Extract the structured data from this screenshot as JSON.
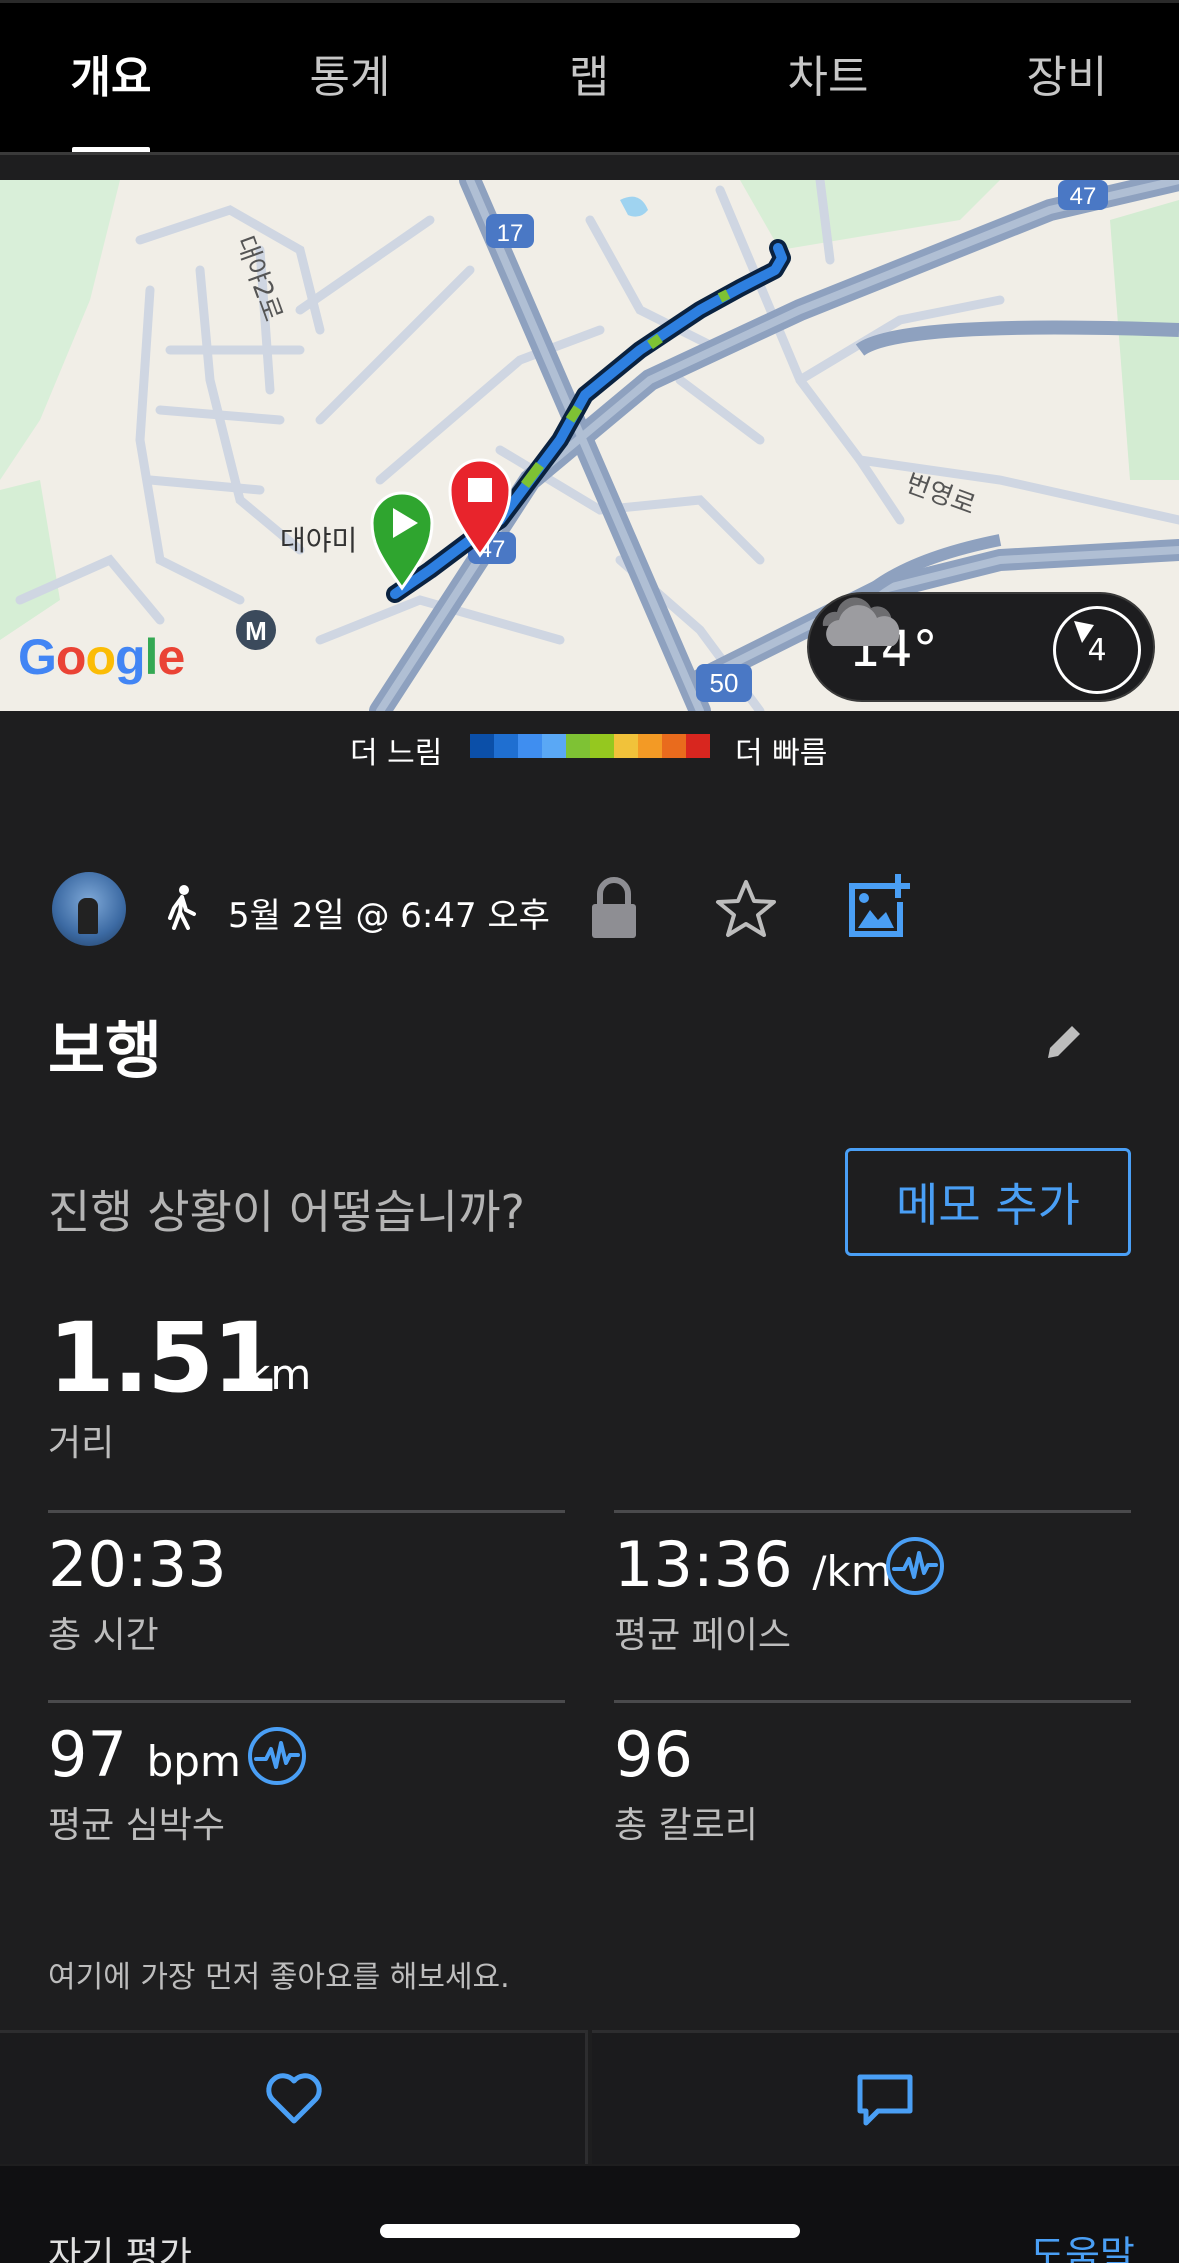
{
  "tabs": [
    {
      "label": "개요",
      "active": true
    },
    {
      "label": "통계",
      "active": false
    },
    {
      "label": "랩",
      "active": false
    },
    {
      "label": "차트",
      "active": false
    },
    {
      "label": "장비",
      "active": false
    }
  ],
  "map": {
    "road_labels": [
      "대야2로",
      "대야미",
      "번영로"
    ],
    "route_shields": [
      "17",
      "47",
      "47",
      "50"
    ],
    "metro_icon_letter": "M",
    "provider_logo": "Google",
    "weather": {
      "temperature": "14°",
      "icon": "cloud-icon",
      "wind_speed": "4"
    }
  },
  "legend": {
    "slow_label": "더 느림",
    "fast_label": "더 빠름",
    "colors": [
      "#0b4fa8",
      "#1f6fd1",
      "#3f8ef0",
      "#5aa8f5",
      "#7ec234",
      "#95c81f",
      "#f1c23a",
      "#f39a25",
      "#e96b1d",
      "#d8261f"
    ]
  },
  "activity": {
    "type_icon": "walk-icon",
    "date": "5월 2일 @ 6:47 오후",
    "title": "보행",
    "prompt": "진행 상황이 어떻습니까?",
    "memo_button": "메모 추가"
  },
  "stats": {
    "distance": {
      "value": "1.51",
      "unit": "km",
      "label": "거리"
    },
    "total_time": {
      "value": "20:33",
      "label": "총 시간"
    },
    "avg_pace": {
      "value": "13:36",
      "unit": "/km",
      "label": "평균 페이스"
    },
    "avg_hr": {
      "value": "97",
      "unit": "bpm",
      "label": "평균 심박수"
    },
    "calories": {
      "value": "96",
      "label": "총 칼로리"
    }
  },
  "social": {
    "first_like_text": "여기에 가장 먼저 좋아요를 해보세요."
  },
  "bottom": {
    "self_evaluation": "자기 평가",
    "help": "도움말"
  },
  "colors": {
    "accent": "#4a9ff5",
    "background": "#1e1e1f",
    "tabbar": "#000000",
    "start_marker": "#2fa52f",
    "stop_marker": "#e8242c"
  }
}
